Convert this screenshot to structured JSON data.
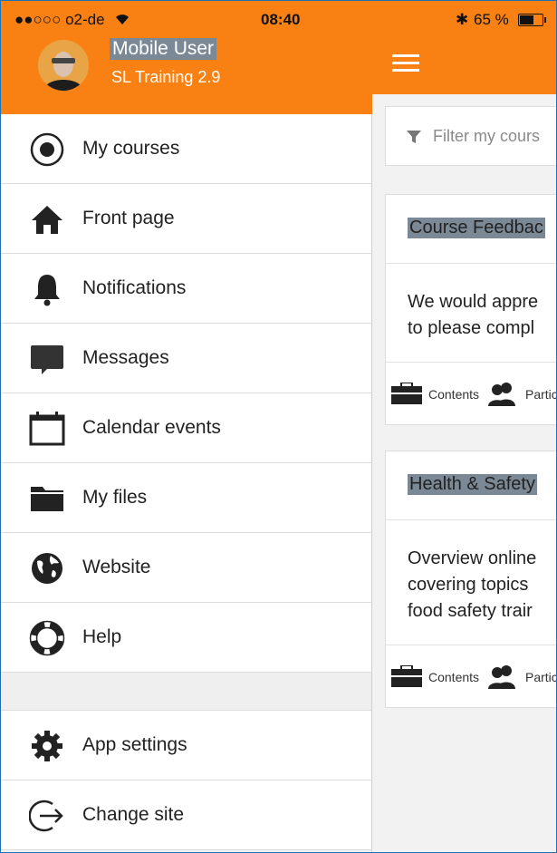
{
  "status": {
    "carrier": "●●○○○ o2-de",
    "time": "08:40",
    "battery": "65 %"
  },
  "user": {
    "name": "Mobile User",
    "site": "SL Training 2.9"
  },
  "menu": {
    "items": [
      {
        "label": "My courses",
        "icon": "record-icon"
      },
      {
        "label": "Front page",
        "icon": "home-icon"
      },
      {
        "label": "Notifications",
        "icon": "bell-icon"
      },
      {
        "label": "Messages",
        "icon": "chat-bubble-icon"
      },
      {
        "label": "Calendar events",
        "icon": "calendar-icon"
      },
      {
        "label": "My files",
        "icon": "folder-icon"
      },
      {
        "label": "Website",
        "icon": "globe-icon"
      },
      {
        "label": "Help",
        "icon": "lifebuoy-icon"
      }
    ],
    "footer_items": [
      {
        "label": "App settings",
        "icon": "gear-icon"
      },
      {
        "label": "Change site",
        "icon": "sign-out-icon"
      }
    ]
  },
  "main": {
    "filter_placeholder": "Filter my cours",
    "courses": [
      {
        "title": "Course Feedbac",
        "summary": [
          "We would appre",
          "to please compl"
        ],
        "contents_label": "Contents",
        "participants_label": "Partic"
      },
      {
        "title": "Health & Safety",
        "summary": [
          "Overview online",
          "covering topics",
          "food safety trair"
        ],
        "contents_label": "Contents",
        "participants_label": "Partic"
      }
    ]
  },
  "colors": {
    "brand": "#f98012",
    "highlight": "#7b8895"
  }
}
